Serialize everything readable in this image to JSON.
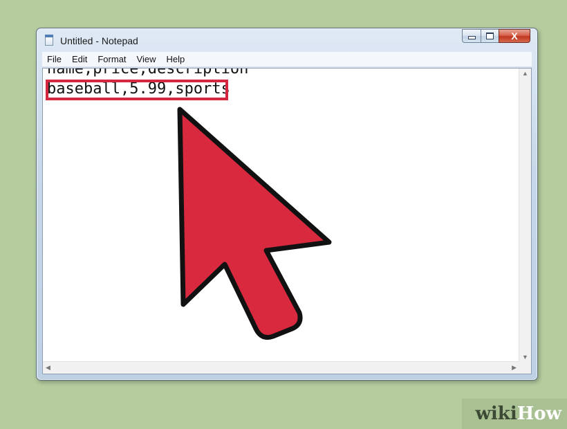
{
  "window": {
    "title": "Untitled - Notepad"
  },
  "controls": {
    "close_glyph": "X"
  },
  "menu": [
    "File",
    "Edit",
    "Format",
    "View",
    "Help"
  ],
  "document": {
    "lines": [
      "name,price,description",
      "baseball,5.99,sports"
    ]
  },
  "annotation": {
    "highlight_color": "#d3283f",
    "arrow_color": "#d8293f"
  },
  "logo": {
    "part1": "wiki",
    "part2": "How"
  }
}
